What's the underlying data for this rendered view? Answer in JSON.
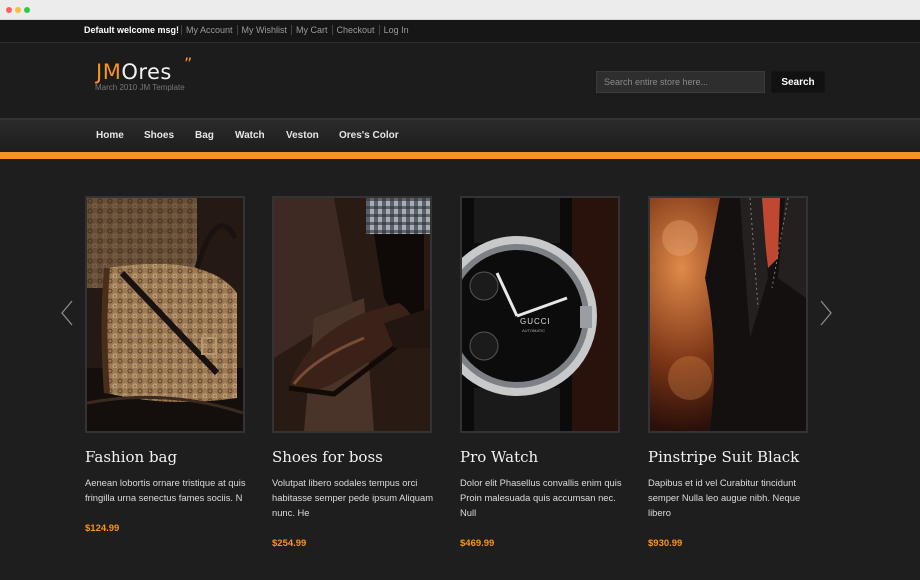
{
  "topbar": {
    "welcome": "Default welcome msg!",
    "links": [
      "My Account",
      "My Wishlist",
      "My Cart",
      "Checkout",
      "Log In"
    ]
  },
  "header": {
    "logo_jm": "JM",
    "logo_ores": "Ores",
    "logo_quote": "”",
    "tagline": "March 2010 JM Template",
    "search_placeholder": "Search entire store here...",
    "search_button": "Search"
  },
  "nav": [
    "Home",
    "Shoes",
    "Bag",
    "Watch",
    "Veston",
    "Ores's Color"
  ],
  "products": [
    {
      "title": "Fashion bag",
      "desc": "Aenean lobortis ornare tristique at quis fringilla urna senectus fames sociis. N",
      "price": "$124.99"
    },
    {
      "title": "Shoes for boss",
      "desc": "Volutpat libero sodales tempus orci habitasse semper pede ipsum Aliquam nunc. He",
      "price": "$254.99"
    },
    {
      "title": "Pro Watch",
      "desc": "Dolor elit Phasellus convallis enim quis Proin malesuada quis accumsan nec. Null",
      "price": "$469.99"
    },
    {
      "title": "Pinstripe Suit Black",
      "desc": "Dapibus et id vel Curabitur tincidunt semper Nulla leo augue nibh. Neque libero",
      "price": "$930.99"
    }
  ],
  "watch_brand": "GUCCI",
  "watch_sub": "AUTOMATIC",
  "icons": {
    "prev": "chevron-left-icon",
    "next": "chevron-right-icon"
  },
  "colors": {
    "accent": "#f7931e",
    "background": "#1e1e1e"
  }
}
